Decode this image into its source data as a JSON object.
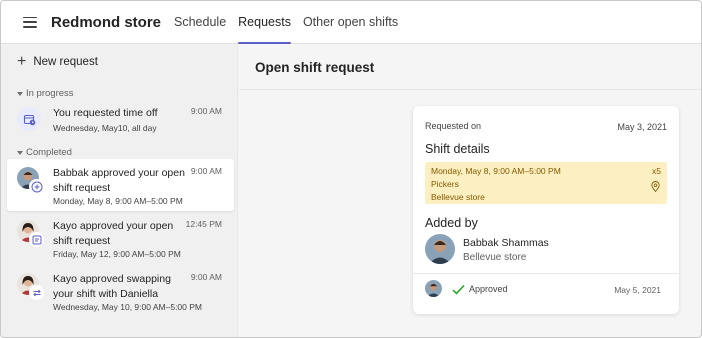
{
  "header": {
    "app_title": "Redmond store",
    "tabs": [
      {
        "label": "Schedule"
      },
      {
        "label": "Requests"
      },
      {
        "label": "Other open shifts"
      }
    ],
    "active_tab": "Requests"
  },
  "sidebar": {
    "new_request_label": "New request",
    "sections": {
      "in_progress": "In progress",
      "completed": "Completed"
    },
    "items": [
      {
        "title": "You requested time off",
        "subtitle": "Wednesday, May10, all day",
        "time": "9:00 AM"
      },
      {
        "title": "Babbak approved your open shift request",
        "subtitle": "Monday, May 8, 9:00 AM–5:00 PM",
        "time": "9:00 AM"
      },
      {
        "title": "Kayo approved your open shift request",
        "subtitle": "Friday, May 12, 9:00 AM–5:00 PM",
        "time": "12:45 PM"
      },
      {
        "title": "Kayo approved swapping your shift with Daniella",
        "subtitle": "Wednesday, May 10, 9:00 AM–5:00 PM",
        "time": "9:00 AM"
      }
    ]
  },
  "detail": {
    "title": "Open shift request",
    "requested_on_label": "Requested on",
    "requested_on_date": "May 3, 2021",
    "shift_details_heading": "Shift details",
    "shift": {
      "when": "Monday, May 8, 9:00 AM–5:00 PM",
      "role": "Pickers",
      "location": "Bellevue store",
      "quantity": "x5"
    },
    "added_by_heading": "Added by",
    "added_by_name": "Babbak Shammas",
    "added_by_store": "Bellevue store",
    "status_label": "Approved",
    "status_date": "May 5, 2021"
  },
  "colors": {
    "accent": "#5b5fc7",
    "shift_bg": "#fcefc1",
    "shift_text": "#835b00",
    "approved_check": "#13a10e"
  }
}
